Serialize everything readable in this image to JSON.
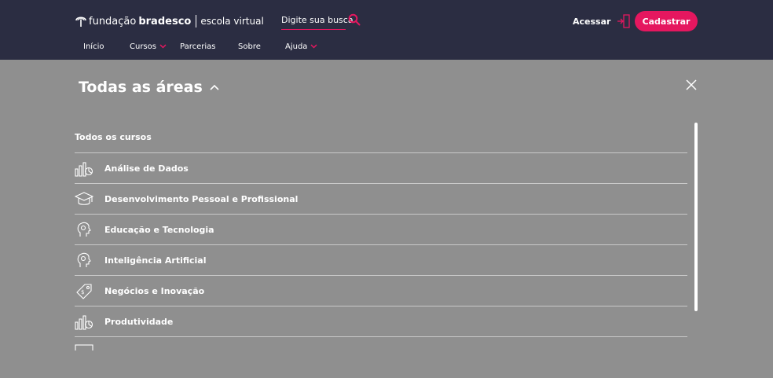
{
  "header": {
    "logo": {
      "word1": "fundação",
      "word2": "bradesco",
      "product": "escola virtual"
    },
    "search": {
      "placeholder": "Digite sua busca"
    },
    "login_label": "Acessar",
    "signup_label": "Cadastrar",
    "nav": [
      "Início",
      "Cursos",
      "Parcerias",
      "Sobre",
      "Ajuda"
    ]
  },
  "panel": {
    "title": "Todas as áreas",
    "all_courses": "Todos os cursos",
    "areas": [
      {
        "label": "Análise de Dados",
        "icon": "data-analysis-icon"
      },
      {
        "label": "Desenvolvimento Pessoal e Profissional",
        "icon": "graduation-cap-icon"
      },
      {
        "label": "Educação e Tecnologia",
        "icon": "head-profile-icon"
      },
      {
        "label": "Inteligência Artificial",
        "icon": "head-profile-icon"
      },
      {
        "label": "Negócios e Inovação",
        "icon": "business-tag-icon"
      },
      {
        "label": "Produtividade",
        "icon": "data-analysis-icon"
      },
      {
        "label": "",
        "icon": "monitor-icon"
      }
    ]
  },
  "colors": {
    "header_bg": "#2b2d42",
    "accent": "#e5175f",
    "overlay": "#8f8f8f",
    "text": "#ffffff"
  }
}
